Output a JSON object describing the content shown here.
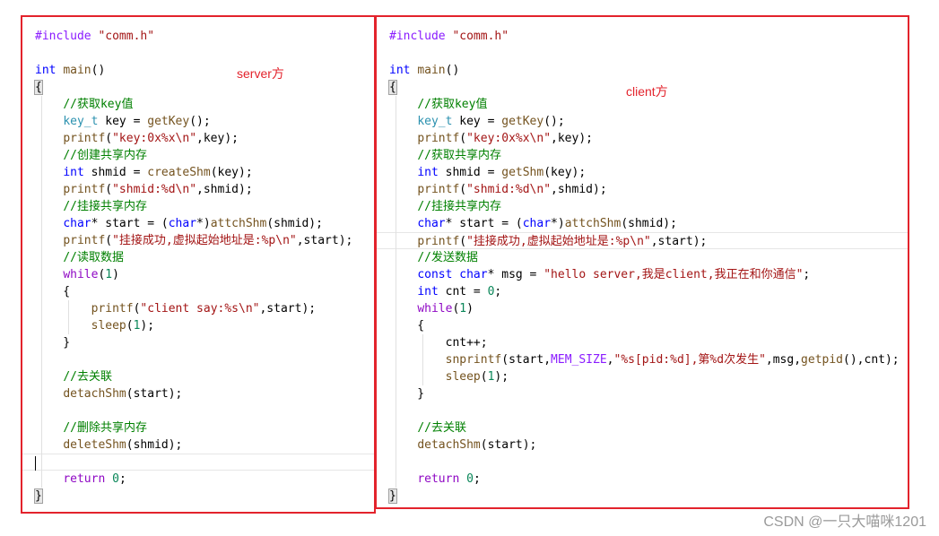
{
  "server": {
    "annotation": "server方",
    "lines": [
      [
        [
          "macro",
          "#include "
        ],
        [
          "str",
          "\"comm.h\""
        ]
      ],
      [],
      [
        [
          "kw",
          "int "
        ],
        [
          "fn",
          "main"
        ],
        [
          "plain",
          "()"
        ]
      ],
      [
        [
          "plain",
          "{"
        ]
      ],
      [
        [
          "plain",
          "    "
        ],
        [
          "cmt",
          "//获取key值"
        ]
      ],
      [
        [
          "plain",
          "    "
        ],
        [
          "type",
          "key_t"
        ],
        [
          "plain",
          " key = "
        ],
        [
          "fn",
          "getKey"
        ],
        [
          "plain",
          "();"
        ]
      ],
      [
        [
          "plain",
          "    "
        ],
        [
          "fn",
          "printf"
        ],
        [
          "plain",
          "("
        ],
        [
          "str",
          "\"key:0x%x\\n\""
        ],
        [
          "plain",
          ",key);"
        ]
      ],
      [
        [
          "plain",
          "    "
        ],
        [
          "cmt",
          "//创建共享内存"
        ]
      ],
      [
        [
          "plain",
          "    "
        ],
        [
          "kw",
          "int "
        ],
        [
          "plain",
          "shmid = "
        ],
        [
          "fn",
          "createShm"
        ],
        [
          "plain",
          "(key);"
        ]
      ],
      [
        [
          "plain",
          "    "
        ],
        [
          "fn",
          "printf"
        ],
        [
          "plain",
          "("
        ],
        [
          "str",
          "\"shmid:%d\\n\""
        ],
        [
          "plain",
          ",shmid);"
        ]
      ],
      [
        [
          "plain",
          "    "
        ],
        [
          "cmt",
          "//挂接共享内存"
        ]
      ],
      [
        [
          "plain",
          "    "
        ],
        [
          "kw",
          "char"
        ],
        [
          "plain",
          "* start = ("
        ],
        [
          "kw",
          "char"
        ],
        [
          "plain",
          "*)"
        ],
        [
          "fn",
          "attchShm"
        ],
        [
          "plain",
          "(shmid);"
        ]
      ],
      [
        [
          "plain",
          "    "
        ],
        [
          "fn",
          "printf"
        ],
        [
          "plain",
          "("
        ],
        [
          "str",
          "\"挂接成功,虚拟起始地址是:%p\\n\""
        ],
        [
          "plain",
          ",start);"
        ]
      ],
      [
        [
          "plain",
          "    "
        ],
        [
          "cmt",
          "//读取数据"
        ]
      ],
      [
        [
          "plain",
          "    "
        ],
        [
          "kw2",
          "while"
        ],
        [
          "plain",
          "("
        ],
        [
          "num",
          "1"
        ],
        [
          "plain",
          ")"
        ]
      ],
      [
        [
          "plain",
          "    {"
        ]
      ],
      [
        [
          "plain",
          "        "
        ],
        [
          "fn",
          "printf"
        ],
        [
          "plain",
          "("
        ],
        [
          "str",
          "\"client say:%s\\n\""
        ],
        [
          "plain",
          ",start);"
        ]
      ],
      [
        [
          "plain",
          "        "
        ],
        [
          "fn",
          "sleep"
        ],
        [
          "plain",
          "("
        ],
        [
          "num",
          "1"
        ],
        [
          "plain",
          ");"
        ]
      ],
      [
        [
          "plain",
          "    }"
        ]
      ],
      [],
      [
        [
          "plain",
          "    "
        ],
        [
          "cmt",
          "//去关联"
        ]
      ],
      [
        [
          "plain",
          "    "
        ],
        [
          "fn",
          "detachShm"
        ],
        [
          "plain",
          "(start);"
        ]
      ],
      [],
      [
        [
          "plain",
          "    "
        ],
        [
          "cmt",
          "//删除共享内存"
        ]
      ],
      [
        [
          "plain",
          "    "
        ],
        [
          "fn",
          "deleteShm"
        ],
        [
          "plain",
          "(shmid);"
        ]
      ],
      [],
      [
        [
          "plain",
          "    "
        ],
        [
          "kw2",
          "return "
        ],
        [
          "num",
          "0"
        ],
        [
          "plain",
          ";"
        ]
      ],
      [
        [
          "plain",
          "}"
        ]
      ]
    ]
  },
  "client": {
    "annotation": "client方",
    "lines": [
      [
        [
          "macro",
          "#include "
        ],
        [
          "str",
          "\"comm.h\""
        ]
      ],
      [],
      [
        [
          "kw",
          "int "
        ],
        [
          "fn",
          "main"
        ],
        [
          "plain",
          "()"
        ]
      ],
      [
        [
          "plain",
          "{"
        ]
      ],
      [
        [
          "plain",
          "    "
        ],
        [
          "cmt",
          "//获取key值"
        ]
      ],
      [
        [
          "plain",
          "    "
        ],
        [
          "type",
          "key_t"
        ],
        [
          "plain",
          " key = "
        ],
        [
          "fn",
          "getKey"
        ],
        [
          "plain",
          "();"
        ]
      ],
      [
        [
          "plain",
          "    "
        ],
        [
          "fn",
          "printf"
        ],
        [
          "plain",
          "("
        ],
        [
          "str",
          "\"key:0x%x\\n\""
        ],
        [
          "plain",
          ",key);"
        ]
      ],
      [
        [
          "plain",
          "    "
        ],
        [
          "cmt",
          "//获取共享内存"
        ]
      ],
      [
        [
          "plain",
          "    "
        ],
        [
          "kw",
          "int "
        ],
        [
          "plain",
          "shmid = "
        ],
        [
          "fn",
          "getShm"
        ],
        [
          "plain",
          "(key);"
        ]
      ],
      [
        [
          "plain",
          "    "
        ],
        [
          "fn",
          "printf"
        ],
        [
          "plain",
          "("
        ],
        [
          "str",
          "\"shmid:%d\\n\""
        ],
        [
          "plain",
          ",shmid);"
        ]
      ],
      [
        [
          "plain",
          "    "
        ],
        [
          "cmt",
          "//挂接共享内存"
        ]
      ],
      [
        [
          "plain",
          "    "
        ],
        [
          "kw",
          "char"
        ],
        [
          "plain",
          "* start = ("
        ],
        [
          "kw",
          "char"
        ],
        [
          "plain",
          "*)"
        ],
        [
          "fn",
          "attchShm"
        ],
        [
          "plain",
          "(shmid);"
        ]
      ],
      [
        [
          "plain",
          "    "
        ],
        [
          "fn",
          "printf"
        ],
        [
          "plain",
          "("
        ],
        [
          "str",
          "\"挂接成功,虚拟起始地址是:%p\\n\""
        ],
        [
          "plain",
          ",start);"
        ]
      ],
      [
        [
          "plain",
          "    "
        ],
        [
          "cmt",
          "//发送数据"
        ]
      ],
      [
        [
          "plain",
          "    "
        ],
        [
          "kw",
          "const char"
        ],
        [
          "plain",
          "* msg = "
        ],
        [
          "str",
          "\"hello server,我是client,我正在和你通信\""
        ],
        [
          "plain",
          ";"
        ]
      ],
      [
        [
          "plain",
          "    "
        ],
        [
          "kw",
          "int "
        ],
        [
          "plain",
          "cnt = "
        ],
        [
          "num",
          "0"
        ],
        [
          "plain",
          ";"
        ]
      ],
      [
        [
          "plain",
          "    "
        ],
        [
          "kw2",
          "while"
        ],
        [
          "plain",
          "("
        ],
        [
          "num",
          "1"
        ],
        [
          "plain",
          ")"
        ]
      ],
      [
        [
          "plain",
          "    {"
        ]
      ],
      [
        [
          "plain",
          "        cnt++;"
        ]
      ],
      [
        [
          "plain",
          "        "
        ],
        [
          "fn",
          "snprintf"
        ],
        [
          "plain",
          "(start,"
        ],
        [
          "macro",
          "MEM_SIZE"
        ],
        [
          "plain",
          ","
        ],
        [
          "str",
          "\"%s[pid:%d],第%d次发生\""
        ],
        [
          "plain",
          ",msg,"
        ],
        [
          "fn",
          "getpid"
        ],
        [
          "plain",
          "(),cnt);"
        ]
      ],
      [
        [
          "plain",
          "        "
        ],
        [
          "fn",
          "sleep"
        ],
        [
          "plain",
          "("
        ],
        [
          "num",
          "1"
        ],
        [
          "plain",
          ");"
        ]
      ],
      [
        [
          "plain",
          "    }"
        ]
      ],
      [],
      [
        [
          "plain",
          "    "
        ],
        [
          "cmt",
          "//去关联"
        ]
      ],
      [
        [
          "plain",
          "    "
        ],
        [
          "fn",
          "detachShm"
        ],
        [
          "plain",
          "(start);"
        ]
      ],
      [],
      [
        [
          "plain",
          "    "
        ],
        [
          "kw2",
          "return "
        ],
        [
          "num",
          "0"
        ],
        [
          "plain",
          ";"
        ]
      ],
      [
        [
          "plain",
          "}"
        ]
      ]
    ]
  },
  "watermark": "CSDN @一只大喵咪1201"
}
